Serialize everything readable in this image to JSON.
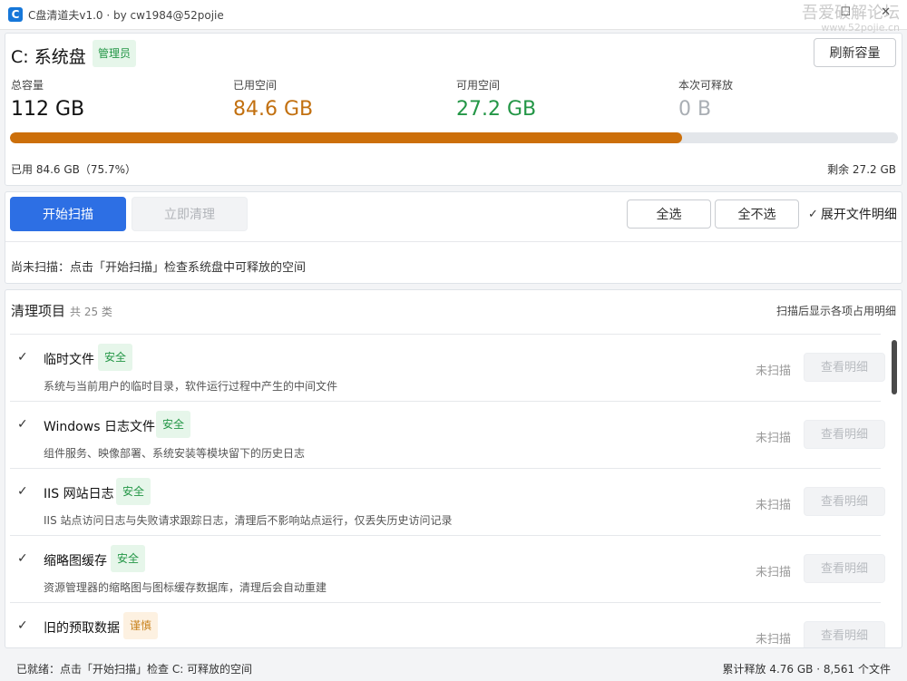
{
  "window": {
    "app_icon_letter": "C",
    "title": "C盘清道夫v1.0 · by cw1984@52pojie",
    "watermark_main": "吾爱破解论坛",
    "watermark_sub": "www.52pojie.cn",
    "maximize_glyph": "☐",
    "close_glyph": "✕"
  },
  "disk": {
    "title": "C: 系统盘",
    "admin_badge": "管理员",
    "refresh_label": "刷新容量",
    "stats": [
      {
        "label": "总容量",
        "value": "112 GB",
        "color": "#111111"
      },
      {
        "label": "已用空间",
        "value": "84.6 GB",
        "color": "#c27010"
      },
      {
        "label": "可用空间",
        "value": "27.2 GB",
        "color": "#239646"
      },
      {
        "label": "本次可释放",
        "value": "0 B",
        "color": "#a9aeb4"
      }
    ],
    "used_fraction": 0.757,
    "used_text": "已用 84.6 GB（75.7%）",
    "free_text": "剩余 27.2 GB"
  },
  "actions": {
    "scan_label": "开始扫描",
    "clean_label": "立即清理",
    "select_all_label": "全选",
    "select_none_label": "全不选",
    "expand_label": "展开文件明细",
    "scan_status": "尚未扫描：点击「开始扫描」检查系统盘中可释放的空间"
  },
  "list": {
    "title": "清理项目",
    "count": "共 25 类",
    "hint": "扫描后显示各项占用明细",
    "items": [
      {
        "name": "临时文件",
        "safety": "安全",
        "level": "safe",
        "desc": "系统与当前用户的临时目录，软件运行过程中产生的中间文件",
        "status": "未扫描",
        "detail": "查看明细"
      },
      {
        "name": "Windows 日志文件",
        "safety": "安全",
        "level": "safe",
        "desc": "组件服务、映像部署、系统安装等模块留下的历史日志",
        "status": "未扫描",
        "detail": "查看明细"
      },
      {
        "name": "IIS 网站日志",
        "safety": "安全",
        "level": "safe",
        "desc": "IIS 站点访问日志与失败请求跟踪日志，清理后不影响站点运行，仅丢失历史访问记录",
        "status": "未扫描",
        "detail": "查看明细"
      },
      {
        "name": "缩略图缓存",
        "safety": "安全",
        "level": "safe",
        "desc": "资源管理器的缩略图与图标缓存数据库，清理后会自动重建",
        "status": "未扫描",
        "detail": "查看明细"
      },
      {
        "name": "旧的预取数据",
        "safety": "谨慎",
        "level": "caution",
        "desc": "",
        "status": "未扫描",
        "detail": "查看明细"
      }
    ]
  },
  "statusbar": {
    "left": "已就绪：点击「开始扫描」检查 C: 可释放的空间",
    "right": "累计释放 4.76 GB · 8,561 个文件"
  }
}
